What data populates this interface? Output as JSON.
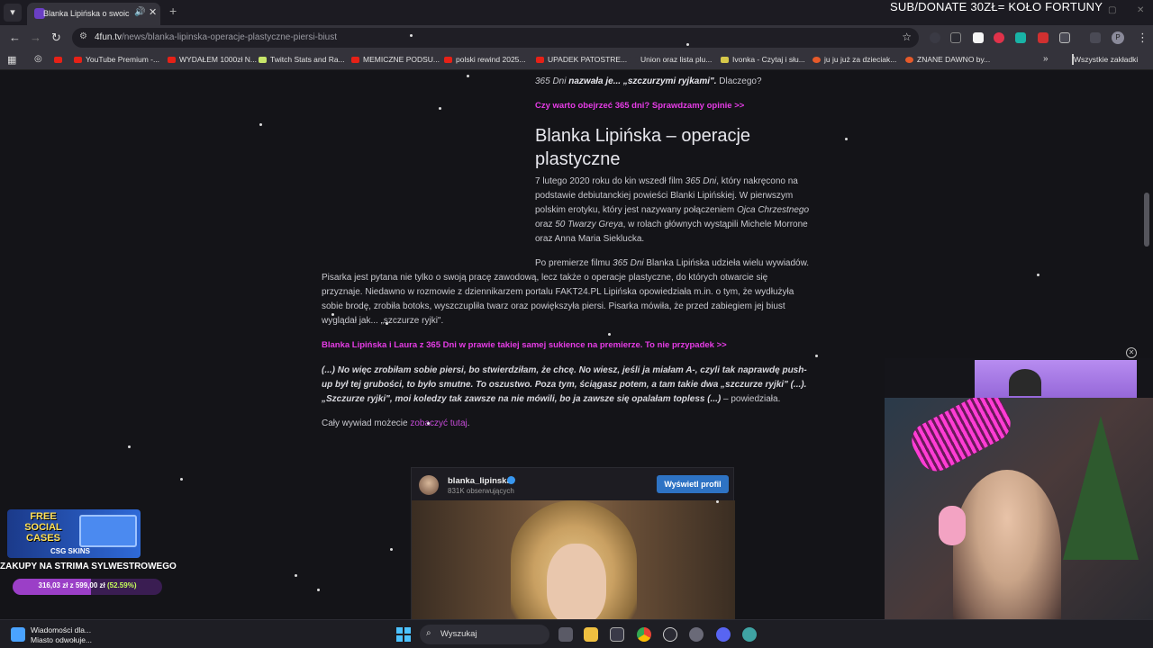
{
  "browser": {
    "tab_title": "Blanka Lipińska o swoich pi",
    "url_domain": "4fun.tv",
    "url_path": "/news/blanka-lipinska-operacje-plastyczne-piersi-biust",
    "bookmarks": [
      {
        "label": "YouTube Premium -..."
      },
      {
        "label": "WYDAŁEM 1000zł N..."
      },
      {
        "label": "Twitch Stats and Ra..."
      },
      {
        "label": "MEMICZNE PODSU..."
      },
      {
        "label": "polski rewind 2025..."
      },
      {
        "label": "UPADEK PATOSTRE..."
      },
      {
        "label": "Union oraz lista plu..."
      },
      {
        "label": "Ivonka - Czytaj i słu..."
      },
      {
        "label": "ju ju już za dzieciak..."
      },
      {
        "label": "ZNANE DAWNO by..."
      }
    ],
    "all_bookmarks": "Wszystkie zakładki",
    "avatar_letter": "P"
  },
  "overlay": {
    "donate": "SUB/DONATE 30ZŁ= KOŁO FORTUNY",
    "promo_title": "FREE SOCIAL CASES",
    "promo_brand": "CSG SKINS",
    "goal_title": "ZAKUPY NA STRIMA SYLWESTROWEGO",
    "goal_amount": "316,03 zł z 599,00 zł",
    "goal_percent_label": "(52.59%)",
    "goal_fraction": 0.5259
  },
  "article": {
    "intro_italic": "365 Dni",
    "intro_bold": " nazwała je... „szczurzymi ryjkami\".",
    "intro_tail": " Dlaczego?",
    "link1": "Czy warto obejrzeć 365 dni? Sprawdzamy opinie >>",
    "heading": "Blanka Lipińska – operacje plastyczne",
    "p1_a": "7 lutego 2020 roku do kin wszedł film ",
    "p1_film": "365 Dni",
    "p1_b": ", który nakręcono na podstawie debiutanckiej powieści Blanki Lipińskiej. W pierwszym polskim erotyku, który jest nazywany połączeniem ",
    "p1_ojciec": "Ojca Chrzestnego",
    "p1_c": " oraz ",
    "p1_grey": "50 Twarzy Greya",
    "p1_d": ", w rolach głównych wystąpili Michele Morrone oraz Anna Maria Sieklucka.",
    "p2_line1_a": "Po premierze filmu ",
    "p2_line1_film": "365 Dni",
    "p2_line1_b": " Blanka Lipińska udzieła wielu wywiadów.",
    "p2_rest": "Pisarka jest pytana nie tylko o swoją pracę zawodową, lecz także o operacje plastyczne, do których otwarcie się przyznaje. Niedawno w rozmowie z dziennikarzem portalu FAKT24.PL Lipińska opowiedziała m.in. o tym, że wydłużyła sobie brodę, zrobiła botoks, wyszczupliła twarz oraz powiększyła piersi. Pisarka mówiła, że przed zabiegiem jej biust wyglądał jak... „szczurze ryjki\".",
    "link2": "Blanka Lipińska i Laura z 365 Dni w prawie takiej samej sukience na premierze. To nie przypadek >>",
    "quote": "(...) No więc zrobiłam sobie piersi, bo stwierdziłam, że chcę. No wiesz, jeśli ja miałam A-, czyli tak naprawdę push-up był tej grubości, to było smutne. To oszustwo. Poza tym, ściągasz potem, a tam takie dwa „szczurze ryjki\" (...). „Szczurze ryjki\", moi koledzy tak zawsze na nie mówili, bo ja zawsze się opalałam topless (...)",
    "quote_tail": " – powiedziała.",
    "outro_a": "Cały wywiad możecie ",
    "outro_link": "zobaczyć tutaj",
    "outro_b": "."
  },
  "instagram": {
    "username": "blanka_lipinska",
    "followers": "831K obserwujących",
    "button": "Wyświetl profil"
  },
  "taskbar": {
    "news_line1": "Wiadomości dla...",
    "news_line2": "Miasto odwołuje...",
    "search_placeholder": "Wyszukaj"
  }
}
